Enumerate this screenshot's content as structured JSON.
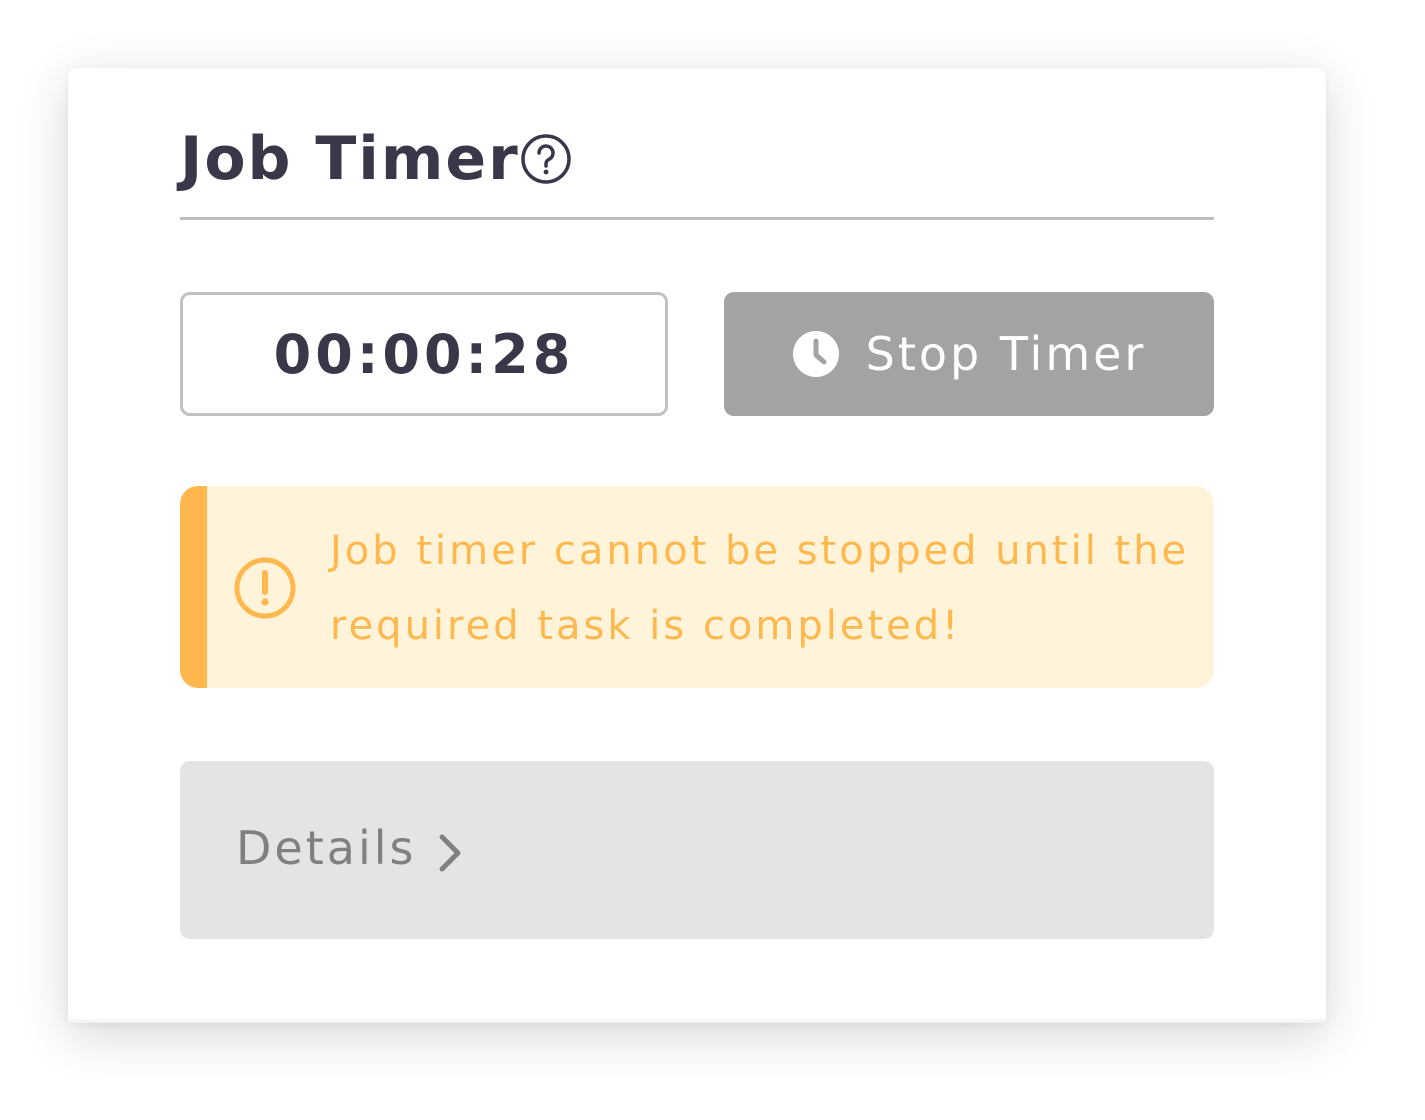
{
  "card": {
    "title": "Job Timer",
    "help_icon": "question-circle-icon"
  },
  "timer": {
    "value": "00:00:28"
  },
  "stop_button": {
    "label": "Stop Timer",
    "icon": "clock-icon",
    "color": "#a3a3a3"
  },
  "alert": {
    "message": "Job timer cannot be stopped until the required task is completed!",
    "icon": "exclamation-circle-icon",
    "accent_color": "#ffb84d",
    "background_color": "#fff4d9"
  },
  "details": {
    "label": "Details",
    "icon": "chevron-right-icon"
  }
}
